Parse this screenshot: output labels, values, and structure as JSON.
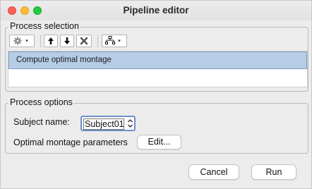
{
  "window": {
    "title": "Pipeline editor"
  },
  "process_selection": {
    "title": "Process selection",
    "toolbar": {
      "items": [
        {
          "icon": "gear-dropdown-icon"
        },
        {
          "icon": "move-up-icon"
        },
        {
          "icon": "move-down-icon"
        },
        {
          "icon": "delete-icon"
        },
        {
          "icon": "pipeline-tree-dropdown-icon"
        }
      ]
    },
    "processes": [
      {
        "label": "Compute optimal montage",
        "selected": true
      }
    ]
  },
  "process_options": {
    "title": "Process options",
    "subject_label": "Subject name:",
    "subject_value": "Subject01",
    "montage_label": "Optimal montage parameters",
    "edit_button": "Edit..."
  },
  "footer": {
    "cancel_button": "Cancel",
    "run_button": "Run"
  },
  "colors": {
    "selection": "#b6cde6",
    "focus_ring": "#6b8fc8"
  }
}
